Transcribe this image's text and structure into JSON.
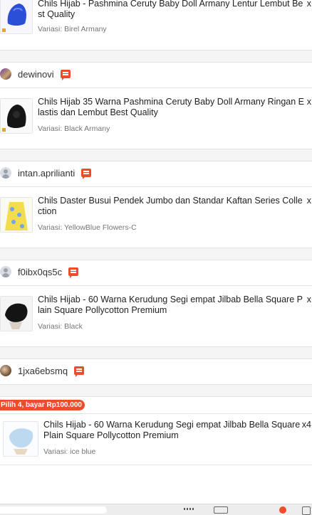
{
  "products": [
    {
      "title": "Chils Hijab - Pashmina Ceruty Baby Doll Armany Lentur Lembut Best Quality",
      "variant": "Variasi: Birel Armany",
      "qty": "x"
    },
    {
      "title": "Chils Hijab 35 Warna Pashmina Ceruty Baby Doll Armany Ringan Elastis dan Lembut Best Quality",
      "variant": "Variasi: Black Armany",
      "qty": "x"
    },
    {
      "title": "Chils Daster Busui Pendek Jumbo dan Standar Kaftan Series Collection",
      "variant": "Variasi: YellowBlue Flowers-C",
      "qty": "x"
    },
    {
      "title": "Chils Hijab - 60 Warna Kerudung Segi empat Jilbab Bella Square Plain Square Pollycotton Premium",
      "variant": "Variasi: Black",
      "qty": "x"
    },
    {
      "title": "Chils Hijab - 60 Warna Kerudung Segi empat Jilbab Bella Square Plain Square Pollycotton Premium",
      "variant": "Variasi: ice blue",
      "qty": "x4"
    }
  ],
  "sellers": [
    {
      "name": "dewinovi",
      "avatar": "photo"
    },
    {
      "name": "intan.aprilianti",
      "avatar": "placeholder"
    },
    {
      "name": "f0ibx0qs5c",
      "avatar": "placeholder"
    },
    {
      "name": "1jxa6ebsmq",
      "avatar": "photo"
    }
  ],
  "promo": {
    "label": "Pilih 4, bayar Rp100.000"
  },
  "colors": {
    "accent": "#ee4d2d",
    "badge": "#e0a43a"
  },
  "icons": [
    "chat-icon",
    "avatar-placeholder-icon"
  ]
}
